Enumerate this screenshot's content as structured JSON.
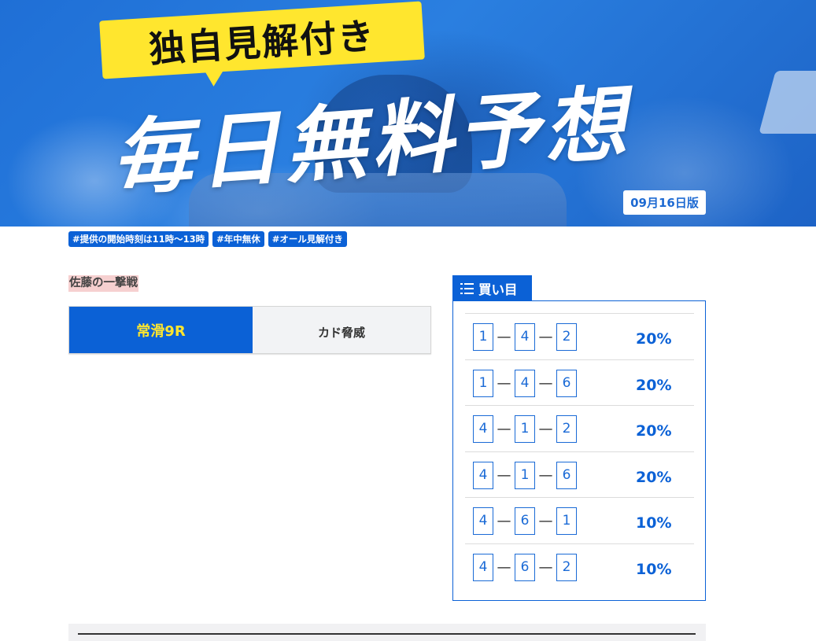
{
  "banner": {
    "bubble_text": "独自見解付き",
    "title": "毎日無料予想",
    "edition": "09月16日版"
  },
  "tags": [
    "#提供の開始時刻は11時〜13時",
    "#年中無休",
    "#オール見解付き"
  ],
  "author": "佐藤の一撃戦",
  "race_tabs": {
    "active": "常滑9R",
    "other": "カド脅威"
  },
  "bets": {
    "header": "買い目",
    "rows": [
      {
        "n1": "1",
        "n2": "4",
        "n3": "2",
        "pct": "20%"
      },
      {
        "n1": "1",
        "n2": "4",
        "n3": "6",
        "pct": "20%"
      },
      {
        "n1": "4",
        "n2": "1",
        "n3": "2",
        "pct": "20%"
      },
      {
        "n1": "4",
        "n2": "1",
        "n3": "6",
        "pct": "20%"
      },
      {
        "n1": "4",
        "n2": "6",
        "n3": "1",
        "pct": "10%"
      },
      {
        "n1": "4",
        "n2": "6",
        "n3": "2",
        "pct": "10%"
      }
    ],
    "dash": "—"
  },
  "colors": {
    "brand_blue": "#0b61d6",
    "highlight_yellow": "#ffe62e",
    "author_highlight": "#f6d0d0"
  }
}
